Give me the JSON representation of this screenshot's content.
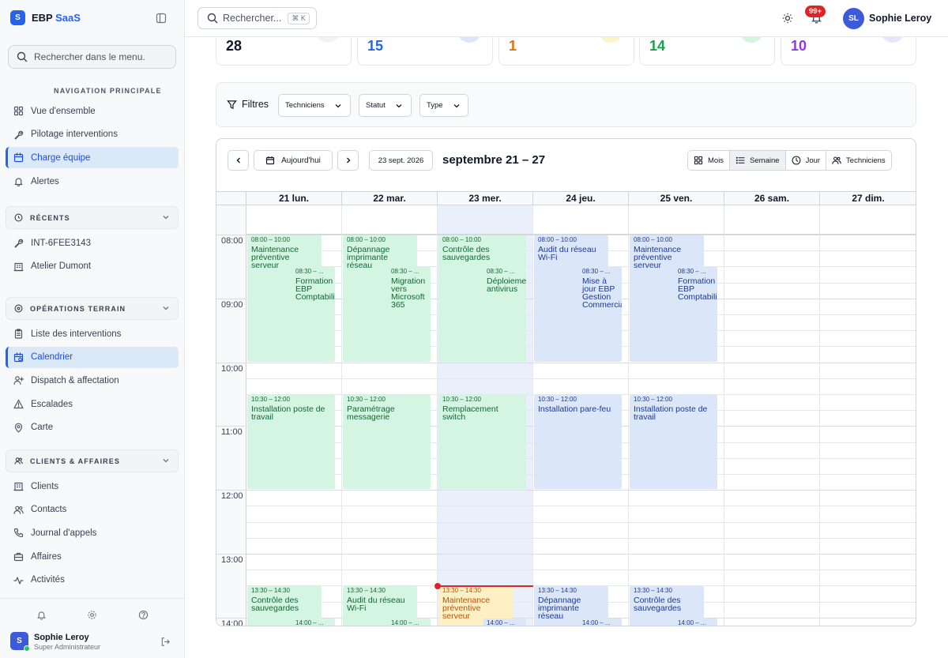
{
  "sidebar": {
    "brand_prefix": "EBP",
    "brand_suffix": "SaaS",
    "logo_letter": "S",
    "search_placeholder": "Rechercher dans le menu.",
    "nav_title": "NAVIGATION PRINCIPALE",
    "main_items": [
      {
        "label": "Vue d'ensemble",
        "icon": "grid-icon"
      },
      {
        "label": "Pilotage interventions",
        "icon": "wrench-icon"
      },
      {
        "label": "Charge équipe",
        "icon": "calendar-icon",
        "active": true
      },
      {
        "label": "Alertes",
        "icon": "bell-icon"
      }
    ],
    "recent_title": "RÉCENTS",
    "recent_items": [
      {
        "label": "INT-6FEE3143",
        "icon": "wrench-icon"
      },
      {
        "label": "Atelier Dumont",
        "icon": "building-icon"
      }
    ],
    "ops_title": "OPÉRATIONS TERRAIN",
    "ops_items": [
      {
        "label": "Liste des interventions",
        "icon": "clipboard-icon"
      },
      {
        "label": "Calendrier",
        "icon": "calendar-clock-icon",
        "active": true
      },
      {
        "label": "Dispatch & affectation",
        "icon": "user-plus-icon"
      },
      {
        "label": "Escalades",
        "icon": "warning-icon"
      },
      {
        "label": "Carte",
        "icon": "map-pin-icon"
      }
    ],
    "clients_title": "CLIENTS & AFFAIRES",
    "client_items": [
      {
        "label": "Clients",
        "icon": "building-icon"
      },
      {
        "label": "Contacts",
        "icon": "users-icon"
      },
      {
        "label": "Journal d'appels",
        "icon": "phone-icon"
      },
      {
        "label": "Affaires",
        "icon": "briefcase-icon"
      },
      {
        "label": "Activités",
        "icon": "activity-icon"
      }
    ],
    "user": {
      "initial": "S",
      "name": "Sophie Leroy",
      "role": "Super Administrateur"
    }
  },
  "topbar": {
    "search_placeholder": "Rechercher...",
    "shortcut": "⌘ K",
    "notif_count": "99+",
    "avatar_initials": "SL",
    "user_name": "Sophie Leroy"
  },
  "stats": [
    {
      "value": "28",
      "color": "#111827",
      "circle": "#f1f3f5"
    },
    {
      "value": "15",
      "color": "#2563eb",
      "circle": "#dbe6f8"
    },
    {
      "value": "1",
      "color": "#d97706",
      "circle": "#fdf3c4"
    },
    {
      "value": "14",
      "color": "#16a34a",
      "circle": "#d3f5e1"
    },
    {
      "value": "10",
      "color": "#9333ea",
      "circle": "#ebe4fb"
    }
  ],
  "filters": {
    "label": "Filtres",
    "technicians": "Techniciens",
    "status": "Statut",
    "type": "Type"
  },
  "calendar": {
    "today_button": "Aujourd'hui",
    "date_button": "23 sept. 2026",
    "title": "septembre 21 – 27",
    "views": [
      {
        "label": "Mois",
        "icon": "grid-icon"
      },
      {
        "label": "Semaine",
        "icon": "list-icon",
        "active": true
      },
      {
        "label": "Jour",
        "icon": "clock-icon"
      },
      {
        "label": "Techniciens",
        "icon": "users-icon"
      }
    ],
    "days": [
      "21 lun.",
      "22 mar.",
      "23 mer.",
      "24 jeu.",
      "25 ven.",
      "26 sam.",
      "27 dim."
    ],
    "hours": [
      "08:00",
      "09:00",
      "10:00",
      "11:00",
      "12:00",
      "13:00",
      "14:00"
    ],
    "events": [
      {
        "day": 0,
        "start": "08:00",
        "end": "10:00",
        "time": "08:00 – 10:00",
        "title": "Maintenance préventive serveur",
        "color": "green",
        "lane": "main"
      },
      {
        "day": 0,
        "start": "08:30",
        "end": "10:00",
        "time": "08:30 – ...",
        "title": "Formation EBP Comptabilité",
        "color": "green",
        "lane": "sub"
      },
      {
        "day": 1,
        "start": "08:00",
        "end": "10:00",
        "time": "08:00 – 10:00",
        "title": "Dépannage imprimante réseau",
        "color": "green",
        "lane": "main"
      },
      {
        "day": 1,
        "start": "08:30",
        "end": "10:00",
        "time": "08:30 – ...",
        "title": "Migration vers Microsoft 365",
        "color": "green",
        "lane": "sub"
      },
      {
        "day": 2,
        "start": "08:00",
        "end": "10:00",
        "time": "08:00 – 10:00",
        "title": "Contrôle des sauvegardes",
        "color": "green",
        "lane": "full"
      },
      {
        "day": 2,
        "start": "08:30",
        "end": "10:00",
        "time": "08:30 – ...",
        "title": "Déploiement antivirus",
        "color": "green",
        "lane": "sub"
      },
      {
        "day": 3,
        "start": "08:00",
        "end": "10:00",
        "time": "08:00 – 10:00",
        "title": "Audit du réseau Wi-Fi",
        "color": "blue",
        "lane": "main"
      },
      {
        "day": 3,
        "start": "08:30",
        "end": "10:00",
        "time": "08:30 – ...",
        "title": "Mise à jour EBP Gestion Commerciale",
        "color": "blue",
        "lane": "sub"
      },
      {
        "day": 4,
        "start": "08:00",
        "end": "10:00",
        "time": "08:00 – 10:00",
        "title": "Maintenance préventive serveur",
        "color": "blue",
        "lane": "main"
      },
      {
        "day": 4,
        "start": "08:30",
        "end": "10:00",
        "time": "08:30 – ...",
        "title": "Formation EBP Comptabilité",
        "color": "blue",
        "lane": "sub"
      },
      {
        "day": 0,
        "start": "10:30",
        "end": "12:00",
        "time": "10:30 – 12:00",
        "title": "Installation poste de travail",
        "color": "green",
        "lane": "full"
      },
      {
        "day": 1,
        "start": "10:30",
        "end": "12:00",
        "time": "10:30 – 12:00",
        "title": "Paramétrage messagerie",
        "color": "green",
        "lane": "full"
      },
      {
        "day": 2,
        "start": "10:30",
        "end": "12:00",
        "time": "10:30 – 12:00",
        "title": "Remplacement switch",
        "color": "green",
        "lane": "full"
      },
      {
        "day": 3,
        "start": "10:30",
        "end": "12:00",
        "time": "10:30 – 12:00",
        "title": "Installation pare-feu",
        "color": "blue",
        "lane": "full"
      },
      {
        "day": 4,
        "start": "10:30",
        "end": "12:00",
        "time": "10:30 – 12:00",
        "title": "Installation poste de travail",
        "color": "blue",
        "lane": "full"
      },
      {
        "day": 0,
        "start": "13:30",
        "end": "14:30",
        "time": "13:30 – 14:30",
        "title": "Contrôle des sauvegardes",
        "color": "green",
        "lane": "main"
      },
      {
        "day": 0,
        "start": "14:00",
        "end": "15:00",
        "time": "14:00 – ...",
        "title": "",
        "color": "green",
        "lane": "sub"
      },
      {
        "day": 1,
        "start": "13:30",
        "end": "14:30",
        "time": "13:30 – 14:30",
        "title": "Audit du réseau Wi-Fi",
        "color": "green",
        "lane": "main"
      },
      {
        "day": 1,
        "start": "14:00",
        "end": "15:00",
        "time": "14:00 – ...",
        "title": "",
        "color": "green",
        "lane": "sub"
      },
      {
        "day": 2,
        "start": "13:30",
        "end": "14:30",
        "time": "13:30 – 14:30",
        "title": "Maintenance préventive serveur",
        "color": "yellow",
        "lane": "main"
      },
      {
        "day": 2,
        "start": "14:00",
        "end": "15:00",
        "time": "14:00 – ...",
        "title": "",
        "color": "blue",
        "lane": "sub"
      },
      {
        "day": 3,
        "start": "13:30",
        "end": "14:30",
        "time": "13:30 – 14:30",
        "title": "Dépannage imprimante réseau",
        "color": "blue",
        "lane": "main"
      },
      {
        "day": 3,
        "start": "14:00",
        "end": "15:00",
        "time": "14:00 – ...",
        "title": "",
        "color": "blue",
        "lane": "sub"
      },
      {
        "day": 4,
        "start": "13:30",
        "end": "14:30",
        "time": "13:30 – 14:30",
        "title": "Contrôle des sauvegardes",
        "color": "blue",
        "lane": "main"
      },
      {
        "day": 4,
        "start": "14:00",
        "end": "15:00",
        "time": "14:00 – ...",
        "title": "",
        "color": "blue",
        "lane": "sub"
      }
    ],
    "now_day": 2,
    "now_time": "13:30"
  }
}
